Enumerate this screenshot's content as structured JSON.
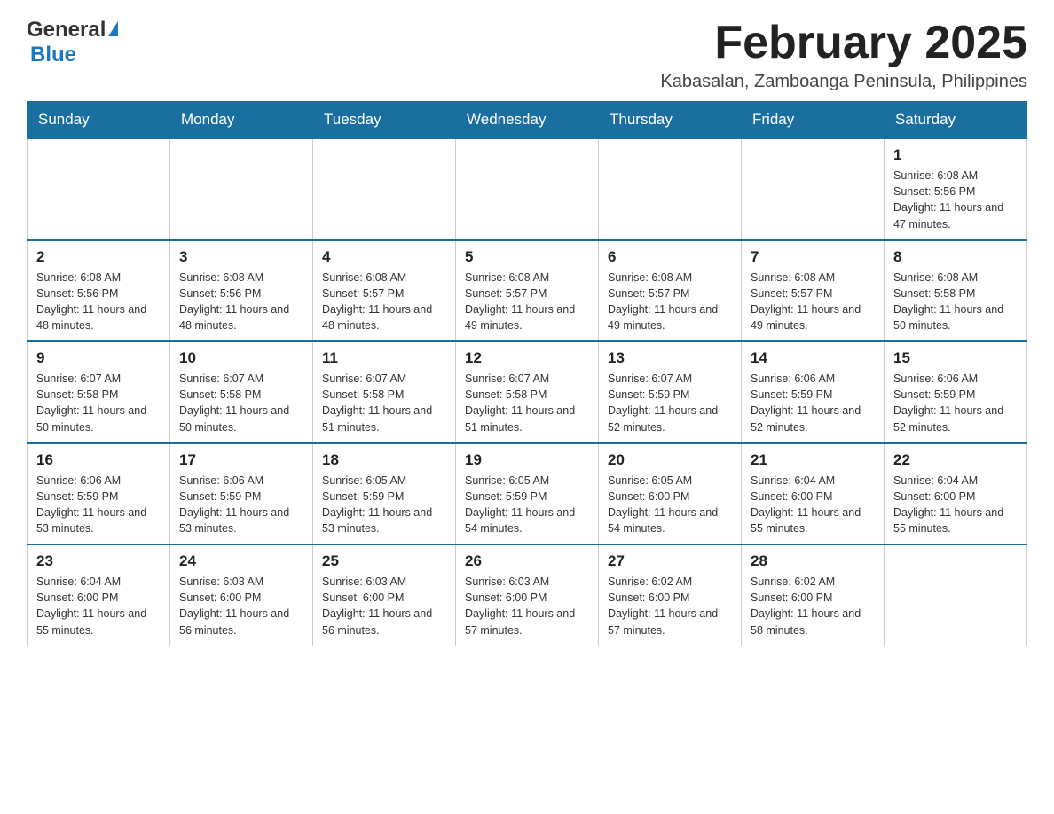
{
  "header": {
    "logo": {
      "general": "General",
      "blue": "Blue"
    },
    "title": "February 2025",
    "location": "Kabasalan, Zamboanga Peninsula, Philippines"
  },
  "days_of_week": [
    "Sunday",
    "Monday",
    "Tuesday",
    "Wednesday",
    "Thursday",
    "Friday",
    "Saturday"
  ],
  "weeks": [
    [
      {
        "day": "",
        "info": ""
      },
      {
        "day": "",
        "info": ""
      },
      {
        "day": "",
        "info": ""
      },
      {
        "day": "",
        "info": ""
      },
      {
        "day": "",
        "info": ""
      },
      {
        "day": "",
        "info": ""
      },
      {
        "day": "1",
        "info": "Sunrise: 6:08 AM\nSunset: 5:56 PM\nDaylight: 11 hours and 47 minutes."
      }
    ],
    [
      {
        "day": "2",
        "info": "Sunrise: 6:08 AM\nSunset: 5:56 PM\nDaylight: 11 hours and 48 minutes."
      },
      {
        "day": "3",
        "info": "Sunrise: 6:08 AM\nSunset: 5:56 PM\nDaylight: 11 hours and 48 minutes."
      },
      {
        "day": "4",
        "info": "Sunrise: 6:08 AM\nSunset: 5:57 PM\nDaylight: 11 hours and 48 minutes."
      },
      {
        "day": "5",
        "info": "Sunrise: 6:08 AM\nSunset: 5:57 PM\nDaylight: 11 hours and 49 minutes."
      },
      {
        "day": "6",
        "info": "Sunrise: 6:08 AM\nSunset: 5:57 PM\nDaylight: 11 hours and 49 minutes."
      },
      {
        "day": "7",
        "info": "Sunrise: 6:08 AM\nSunset: 5:57 PM\nDaylight: 11 hours and 49 minutes."
      },
      {
        "day": "8",
        "info": "Sunrise: 6:08 AM\nSunset: 5:58 PM\nDaylight: 11 hours and 50 minutes."
      }
    ],
    [
      {
        "day": "9",
        "info": "Sunrise: 6:07 AM\nSunset: 5:58 PM\nDaylight: 11 hours and 50 minutes."
      },
      {
        "day": "10",
        "info": "Sunrise: 6:07 AM\nSunset: 5:58 PM\nDaylight: 11 hours and 50 minutes."
      },
      {
        "day": "11",
        "info": "Sunrise: 6:07 AM\nSunset: 5:58 PM\nDaylight: 11 hours and 51 minutes."
      },
      {
        "day": "12",
        "info": "Sunrise: 6:07 AM\nSunset: 5:58 PM\nDaylight: 11 hours and 51 minutes."
      },
      {
        "day": "13",
        "info": "Sunrise: 6:07 AM\nSunset: 5:59 PM\nDaylight: 11 hours and 52 minutes."
      },
      {
        "day": "14",
        "info": "Sunrise: 6:06 AM\nSunset: 5:59 PM\nDaylight: 11 hours and 52 minutes."
      },
      {
        "day": "15",
        "info": "Sunrise: 6:06 AM\nSunset: 5:59 PM\nDaylight: 11 hours and 52 minutes."
      }
    ],
    [
      {
        "day": "16",
        "info": "Sunrise: 6:06 AM\nSunset: 5:59 PM\nDaylight: 11 hours and 53 minutes."
      },
      {
        "day": "17",
        "info": "Sunrise: 6:06 AM\nSunset: 5:59 PM\nDaylight: 11 hours and 53 minutes."
      },
      {
        "day": "18",
        "info": "Sunrise: 6:05 AM\nSunset: 5:59 PM\nDaylight: 11 hours and 53 minutes."
      },
      {
        "day": "19",
        "info": "Sunrise: 6:05 AM\nSunset: 5:59 PM\nDaylight: 11 hours and 54 minutes."
      },
      {
        "day": "20",
        "info": "Sunrise: 6:05 AM\nSunset: 6:00 PM\nDaylight: 11 hours and 54 minutes."
      },
      {
        "day": "21",
        "info": "Sunrise: 6:04 AM\nSunset: 6:00 PM\nDaylight: 11 hours and 55 minutes."
      },
      {
        "day": "22",
        "info": "Sunrise: 6:04 AM\nSunset: 6:00 PM\nDaylight: 11 hours and 55 minutes."
      }
    ],
    [
      {
        "day": "23",
        "info": "Sunrise: 6:04 AM\nSunset: 6:00 PM\nDaylight: 11 hours and 55 minutes."
      },
      {
        "day": "24",
        "info": "Sunrise: 6:03 AM\nSunset: 6:00 PM\nDaylight: 11 hours and 56 minutes."
      },
      {
        "day": "25",
        "info": "Sunrise: 6:03 AM\nSunset: 6:00 PM\nDaylight: 11 hours and 56 minutes."
      },
      {
        "day": "26",
        "info": "Sunrise: 6:03 AM\nSunset: 6:00 PM\nDaylight: 11 hours and 57 minutes."
      },
      {
        "day": "27",
        "info": "Sunrise: 6:02 AM\nSunset: 6:00 PM\nDaylight: 11 hours and 57 minutes."
      },
      {
        "day": "28",
        "info": "Sunrise: 6:02 AM\nSunset: 6:00 PM\nDaylight: 11 hours and 58 minutes."
      },
      {
        "day": "",
        "info": ""
      }
    ]
  ]
}
